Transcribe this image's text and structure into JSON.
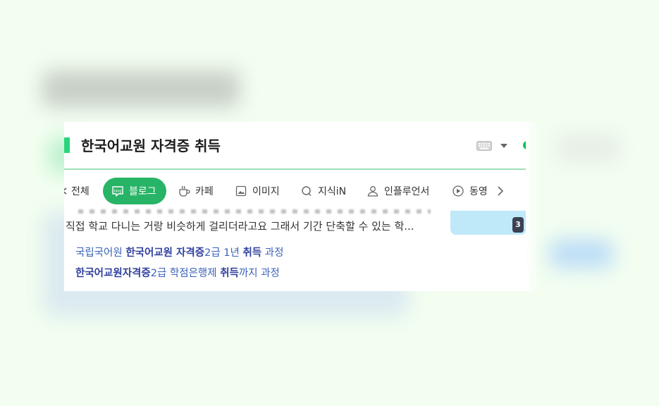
{
  "search": {
    "query": "한국어교원 자격증 취득"
  },
  "tabs": [
    {
      "label": "전체",
      "icon": "all-icon"
    },
    {
      "label": "블로그",
      "icon": "blog-icon",
      "active": true
    },
    {
      "label": "카페",
      "icon": "cafe-icon"
    },
    {
      "label": "이미지",
      "icon": "image-icon"
    },
    {
      "label": "지식iN",
      "icon": "kin-icon"
    },
    {
      "label": "인플루언서",
      "icon": "influencer-icon"
    },
    {
      "label": "동영",
      "icon": "video-icon"
    }
  ],
  "result": {
    "snippet": "직접 학교 다니는 거랑 비슷하게 걸리더라고요 그래서 기간 단축할 수 있는 학...",
    "thumbnail_count": "3",
    "links": [
      {
        "parts": [
          {
            "text": "국립국어원 ",
            "bold": false
          },
          {
            "text": "한국어교원 자격증",
            "bold": true
          },
          {
            "text": "2급 1년 ",
            "bold": false
          },
          {
            "text": "취득",
            "bold": true
          },
          {
            "text": " 과정",
            "bold": false
          }
        ]
      },
      {
        "parts": [
          {
            "text": "한국어교원자격증",
            "bold": true
          },
          {
            "text": "2급 학점은행제 ",
            "bold": false
          },
          {
            "text": "취득",
            "bold": true
          },
          {
            "text": "까지 과정",
            "bold": false
          }
        ]
      }
    ]
  },
  "colors": {
    "accent": "#03c75a",
    "active_tab": "#28b467",
    "link": "#3a62b8",
    "background": "#f3fef1"
  }
}
